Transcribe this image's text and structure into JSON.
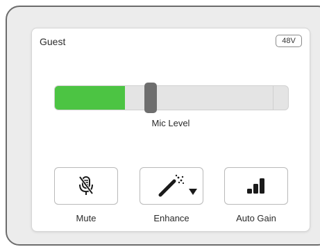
{
  "channel": {
    "name": "Guest",
    "phantom_power_label": "48V",
    "mic_level_label": "Mic Level",
    "signal_level_fraction": 0.3,
    "gain_fraction": 0.41,
    "peak_fraction": 0.935,
    "signal_color": "#4cc443"
  },
  "controls": [
    {
      "label": "Mute",
      "icon": "mic-muted-icon"
    },
    {
      "label": "Enhance",
      "icon": "magic-wand-icon",
      "has_dropdown": true
    },
    {
      "label": "Auto Gain",
      "icon": "auto-gain-bars-icon"
    }
  ]
}
